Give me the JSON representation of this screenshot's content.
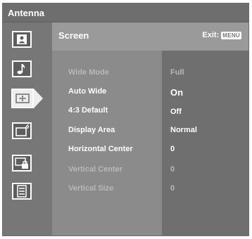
{
  "header": {
    "title": "Antenna"
  },
  "panel": {
    "title": "Screen",
    "exit_label": "Exit:",
    "menu_key": "MENU"
  },
  "sidebar": {
    "icons": [
      {
        "name": "picture-icon"
      },
      {
        "name": "sound-icon"
      },
      {
        "name": "screen-icon",
        "active": true
      },
      {
        "name": "channel-icon"
      },
      {
        "name": "parental-lock-icon"
      },
      {
        "name": "setup-icon"
      }
    ]
  },
  "settings": [
    {
      "label": "Wide Mode",
      "value": "Full",
      "enabled": false
    },
    {
      "label": "Auto Wide",
      "value": "On",
      "enabled": true
    },
    {
      "label": "4:3 Default",
      "value": "Off",
      "enabled": true
    },
    {
      "label": "Display Area",
      "value": "Normal",
      "enabled": true
    },
    {
      "label": "Horizontal Center",
      "value": "0",
      "enabled": true
    },
    {
      "label": "Vertical Center",
      "value": "0",
      "enabled": false
    },
    {
      "label": "Vertical Size",
      "value": "0",
      "enabled": false
    }
  ],
  "colors": {
    "panel_bg": "#9a9a9a",
    "labels_bg": "#8b8b8b",
    "values_bg": "#6f6f6f",
    "enabled_text": "#ffffff",
    "disabled_text": "#b8b8b8"
  }
}
